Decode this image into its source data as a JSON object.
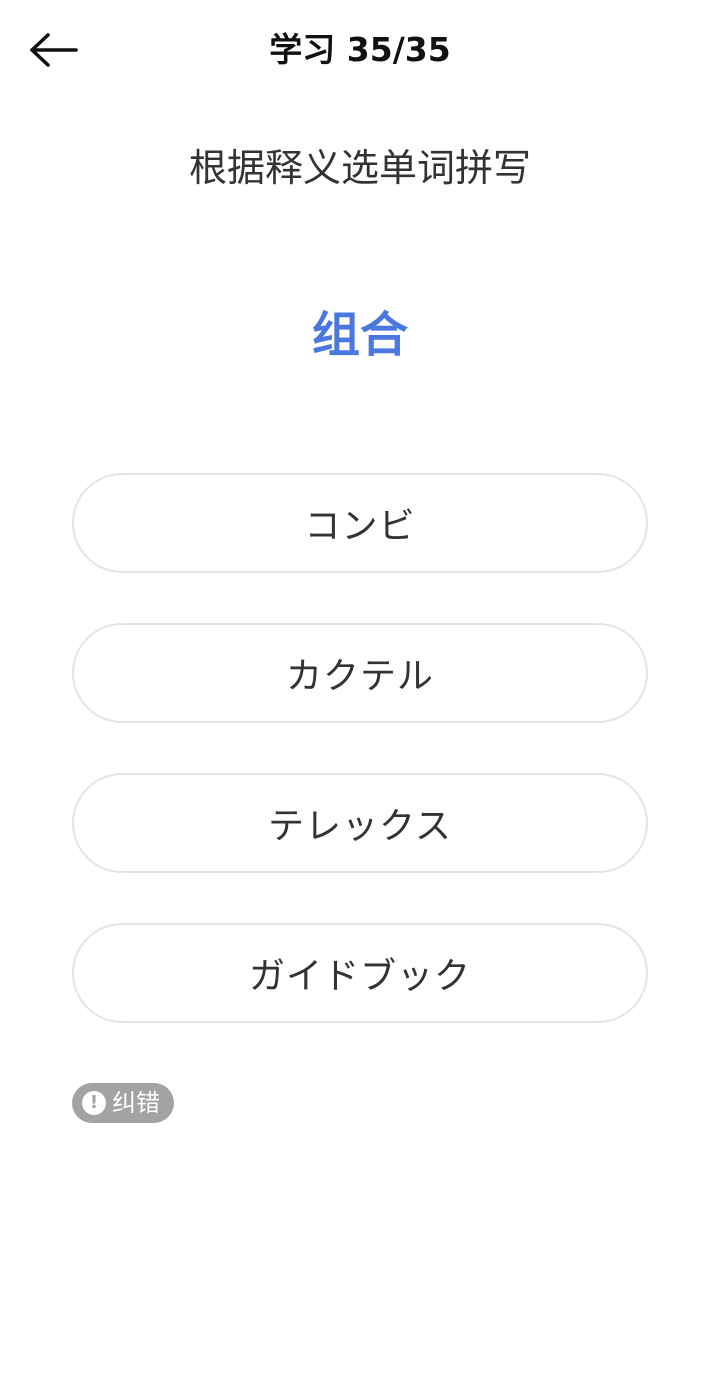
{
  "header": {
    "back_icon": "arrow-left-icon",
    "title": "学习 35/35"
  },
  "question": {
    "instruction": "根据释义选单词拼写",
    "meaning": "组合"
  },
  "options": [
    {
      "label": "コンビ"
    },
    {
      "label": "カクテル"
    },
    {
      "label": "テレックス"
    },
    {
      "label": "ガイドブック"
    }
  ],
  "report": {
    "icon": "exclamation-circle-icon",
    "icon_glyph": "!",
    "label": "纠错"
  },
  "colors": {
    "accent": "#4a78e0",
    "badge": "#a3a3a3",
    "option_border": "#e4e4e4"
  }
}
